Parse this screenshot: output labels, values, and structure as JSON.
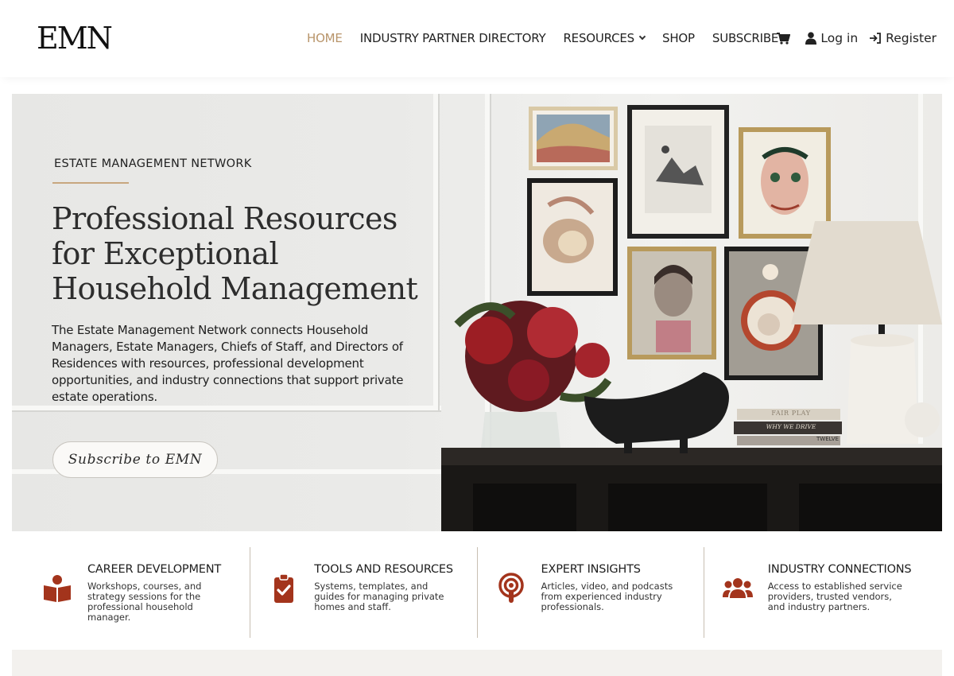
{
  "brand": {
    "logo_text": "EMN"
  },
  "nav": {
    "items": [
      {
        "label": "HOME",
        "active": true
      },
      {
        "label": "INDUSTRY PARTNER DIRECTORY"
      },
      {
        "label": "RESOURCES",
        "has_dropdown": true
      },
      {
        "label": "SHOP"
      },
      {
        "label": "SUBSCRIBE"
      }
    ],
    "cart_icon": "cart-icon",
    "login_label": "Log in",
    "register_label": "Register"
  },
  "hero": {
    "eyebrow": "ESTATE MANAGEMENT NETWORK",
    "title": "Professional Resources for Exceptional Household Management",
    "body": "The Estate Management Network connects Household Managers, Estate Managers, Chiefs of Staff, and Directors of Residences with resources, professional development opportunities, and industry connections that support private estate operations.",
    "cta_label": "Subscribe to EMN",
    "book_spines": [
      "FAIR PLAY",
      "WHY WE DRIVE",
      "TWELVE"
    ]
  },
  "features": [
    {
      "icon": "book-reader-icon",
      "title": "CAREER DEVELOPMENT",
      "description": "Workshops, courses, and strategy sessions for the professional household manager."
    },
    {
      "icon": "clipboard-check-icon",
      "title": "TOOLS AND RESOURCES",
      "description": "Systems, templates, and guides for managing private homes and staff."
    },
    {
      "icon": "podcast-icon",
      "title": "EXPERT INSIGHTS",
      "description": "Articles, video, and podcasts from experienced industry professionals."
    },
    {
      "icon": "users-icon",
      "title": "INDUSTRY CONNECTIONS",
      "description": "Access to established service providers, trusted vendors, and industry partners."
    }
  ],
  "colors": {
    "accent_gold": "#b8946a",
    "icon_rust": "#a3341c",
    "divider": "#c8bfb2"
  }
}
